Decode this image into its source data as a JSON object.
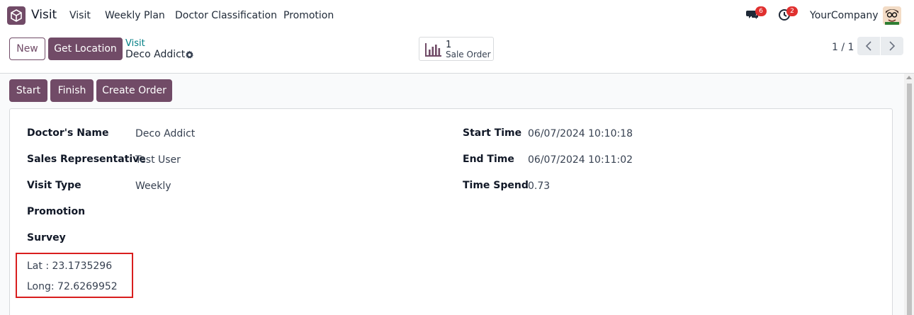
{
  "navbar": {
    "app_name": "Visit",
    "menu": [
      "Visit",
      "Weekly Plan",
      "Doctor Classification",
      "Promotion"
    ],
    "messages_count": "6",
    "activities_count": "2",
    "company": "YourCompany"
  },
  "control": {
    "new_label": "New",
    "get_location_label": "Get Location",
    "breadcrumb": "Visit",
    "record_title": "Deco Addict",
    "smart_button": {
      "count": "1",
      "label": "Sale Order"
    },
    "pager": "1 / 1"
  },
  "statusbar": {
    "start_label": "Start",
    "finish_label": "Finish",
    "create_order_label": "Create Order"
  },
  "form": {
    "left": [
      {
        "label": "Doctor's Name",
        "value": "Deco Addict"
      },
      {
        "label": "Sales Representative",
        "value": "Test User"
      },
      {
        "label": "Visit Type",
        "value": "Weekly"
      },
      {
        "label": "Promotion",
        "value": ""
      },
      {
        "label": "Survey",
        "value": ""
      }
    ],
    "right": [
      {
        "label": "Start Time",
        "value": "06/07/2024 10:10:18"
      },
      {
        "label": "End Time",
        "value": "06/07/2024 10:11:02"
      },
      {
        "label": "Time Spend",
        "value": "0.73"
      }
    ],
    "latitude_text": "Lat : 23.1735296",
    "longitude_text": "Long: 72.6269952"
  },
  "colors": {
    "brand": "#714b67",
    "link": "#017e84",
    "badge": "#e0302f",
    "highlight": "#d91e1e"
  }
}
